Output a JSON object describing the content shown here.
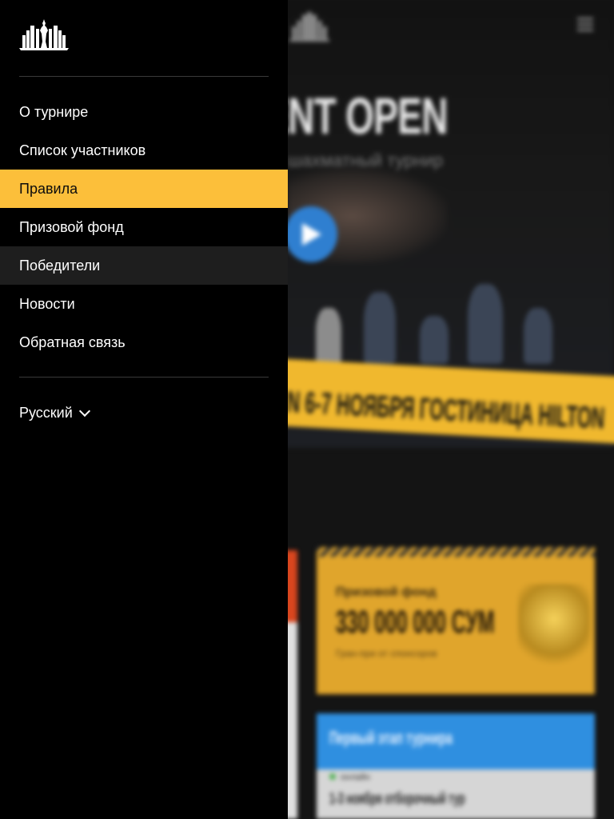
{
  "drawer": {
    "menu_items": [
      {
        "label": "О турнире",
        "state": "default"
      },
      {
        "label": "Список участников",
        "state": "default"
      },
      {
        "label": "Правила",
        "state": "active"
      },
      {
        "label": "Призовой фонд",
        "state": "default"
      },
      {
        "label": "Победители",
        "state": "hover"
      },
      {
        "label": "Новости",
        "state": "default"
      },
      {
        "label": "Обратная связь",
        "state": "default"
      }
    ],
    "language": {
      "selected": "Русский",
      "icon": "chevron-down-icon"
    },
    "logo_icon": "chess-castle-logo-icon"
  },
  "background_page": {
    "hero_title": "ENT OPEN",
    "hero_subtitle": "шахматный турнир",
    "event_band": "N 6-7 НОЯБРЯ ГОСТИНИЦА HILTON",
    "prize": {
      "label": "Призовой фонд",
      "amount": "330 000 000 СУМ",
      "note": "Гран-при от спонсоров"
    },
    "stage": {
      "title": "Первый этап турнира",
      "status": "онлайн",
      "date": "1-3 ноября отборочный тур"
    }
  },
  "colors": {
    "drawer_bg": "#000000",
    "accent": "#fcbf3a",
    "hover_bg": "#1e1e1e",
    "play_button": "#2f7fd0",
    "stage_header": "#2f8fe0"
  }
}
